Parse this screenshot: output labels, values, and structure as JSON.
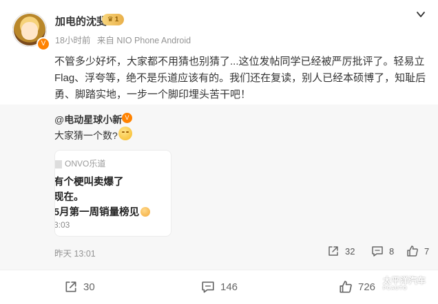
{
  "post": {
    "username": "加电的沈斐",
    "vip_level": "1",
    "time": "18小时前",
    "source": "来自 NIO Phone Android",
    "text": "不管多少好坏，大家都不用猜也别猜了...这位发帖同学已经被严厉批评了。轻易立Flag、浮夸等，绝不是乐道应该有的。我们还在复读，别人已经本硕博了，知耻后勇、脚踏实地，一步一个脚印埋头苦干吧！"
  },
  "repost": {
    "author_at": "@",
    "author": "电动星球小新",
    "text": "大家猜一个数?",
    "card": {
      "source": "ONVO乐道",
      "line1": "有个梗叫卖爆了",
      "line2": "现在。",
      "line3": "5月第一周销量榜见",
      "time": "3:03"
    },
    "time": "昨天 13:01",
    "share_count": "32",
    "comment_count": "8",
    "like_count": "7"
  },
  "footer": {
    "share_count": "30",
    "comment_count": "146",
    "like_count": "726"
  },
  "watermark": {
    "text": "太平洋汽车",
    "sub": "PCAUTO"
  },
  "icons": {
    "share": "share-icon",
    "comment": "comment-icon",
    "like": "thumbs-up-icon",
    "more": "chevron-down-icon"
  }
}
